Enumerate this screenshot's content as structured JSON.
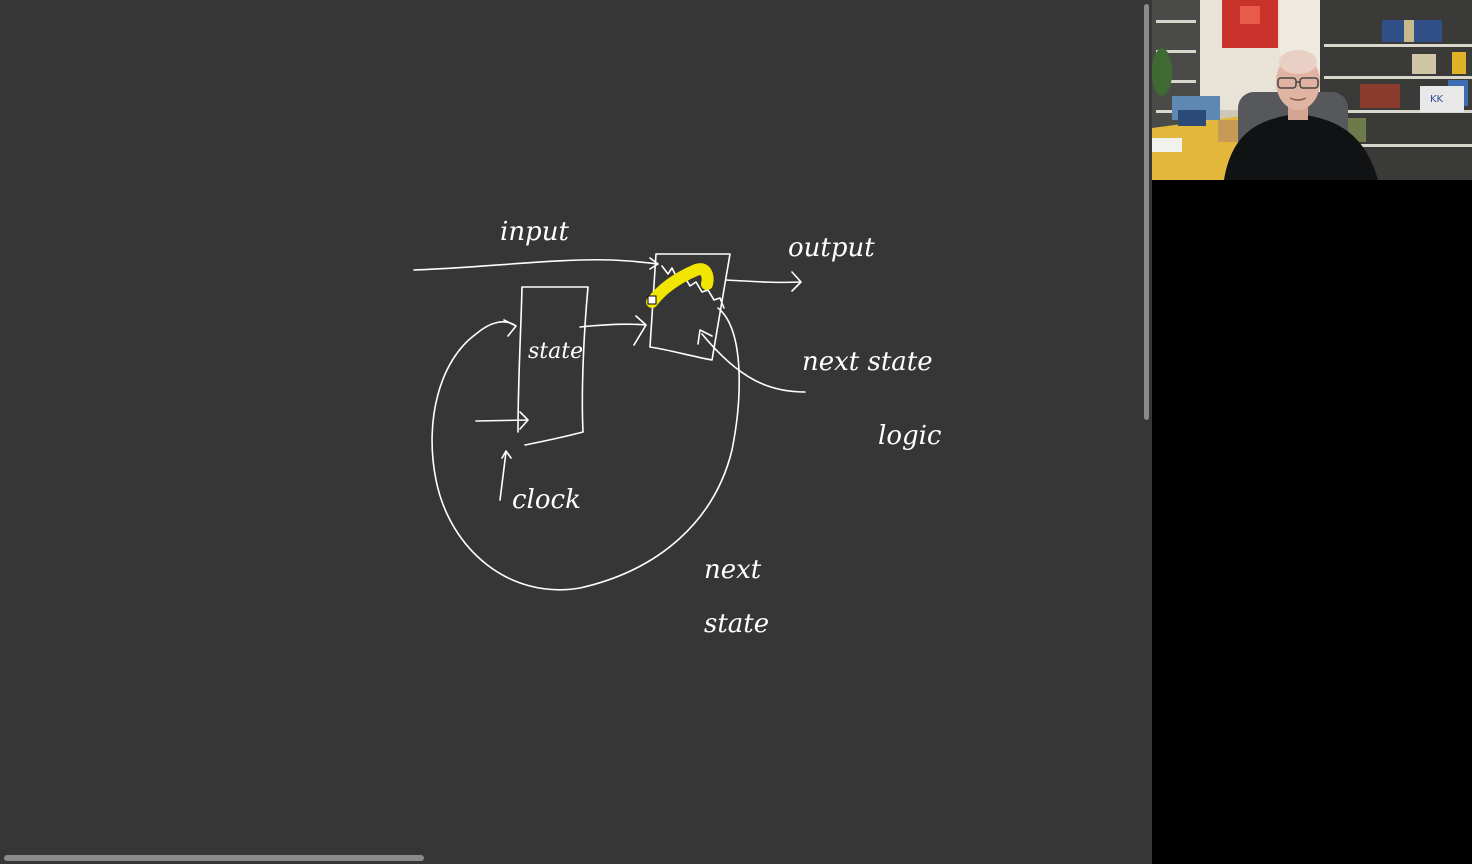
{
  "whiteboard": {
    "labels": {
      "input": "input",
      "output": "output",
      "state": "state",
      "clock": "clock",
      "next_state_logic_line1": "next state",
      "next_state_logic_line2": "logic",
      "next_state_line1": "next",
      "next_state_line2": "state"
    },
    "ink_color": "#ffffff",
    "highlight_color": "#f2e600",
    "background": "#363636"
  },
  "video": {
    "participant": "presenter webcam",
    "badge_text": "KK"
  }
}
